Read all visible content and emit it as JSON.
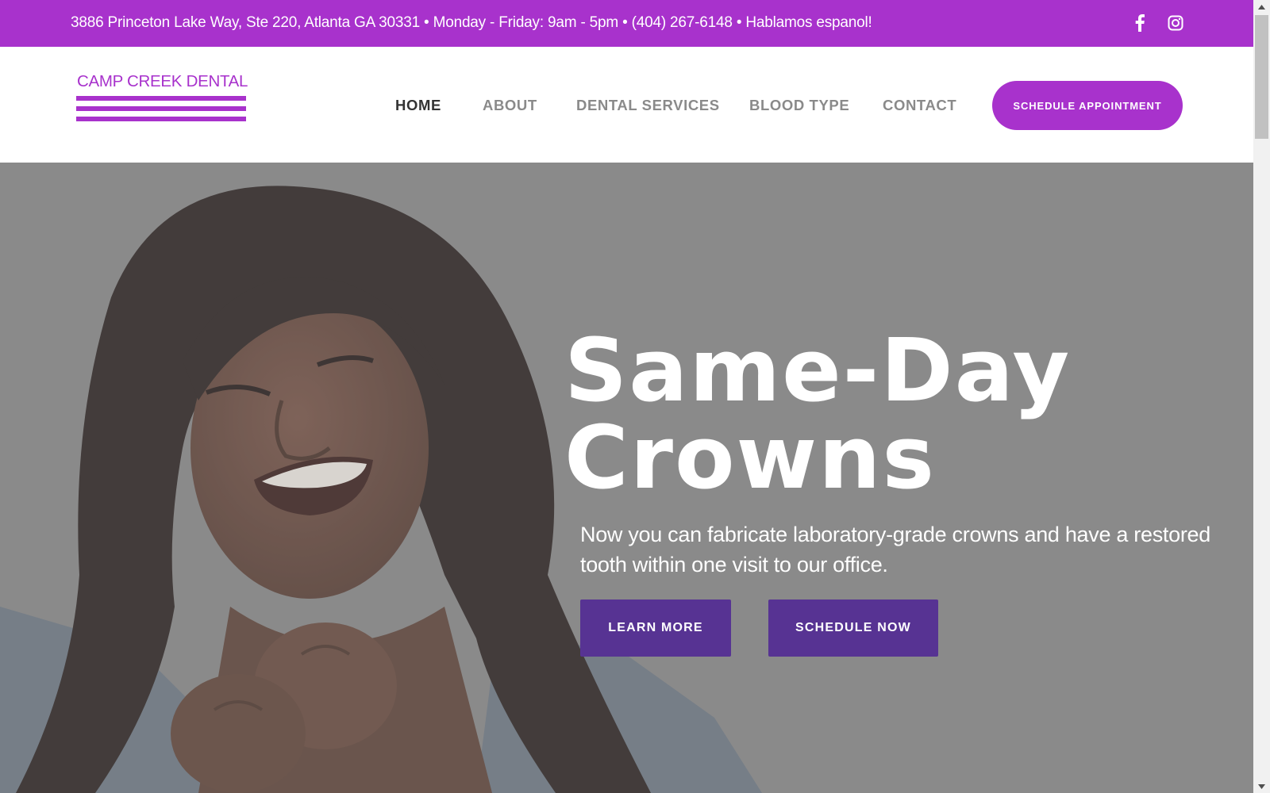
{
  "topbar": {
    "info": "3886 Princeton Lake Way, Ste 220, Atlanta GA 30331 • Monday - Friday: 9am - 5pm • (404) 267-6148 • Hablamos espanol!",
    "social": [
      {
        "icon": "facebook-icon"
      },
      {
        "icon": "instagram-icon"
      }
    ],
    "background": "#a832cc"
  },
  "header": {
    "logo_text": "CAMP CREEK DENTAL",
    "nav": [
      {
        "label": "HOME",
        "active": true
      },
      {
        "label": "ABOUT",
        "active": false
      },
      {
        "label": "DENTAL SERVICES",
        "active": false
      },
      {
        "label": "BLOOD TYPE",
        "active": false
      },
      {
        "label": "CONTACT",
        "active": false
      }
    ],
    "cta_label": "SCHEDULE APPOINTMENT"
  },
  "hero": {
    "title_line1": "Same-Day",
    "title_line2": "Crowns",
    "subtitle": "Now you can fabricate laboratory-grade crowns and have a restored tooth within one visit to our office.",
    "learn_more_label": "LEARN MORE",
    "schedule_now_label": "SCHEDULE NOW",
    "button_color": "#573393",
    "overlay_color": "#8a8a8a"
  },
  "colors": {
    "brand_purple": "#a832cc",
    "button_purple": "#573393",
    "nav_active": "#333333",
    "nav_inactive": "#8a8a8a"
  }
}
